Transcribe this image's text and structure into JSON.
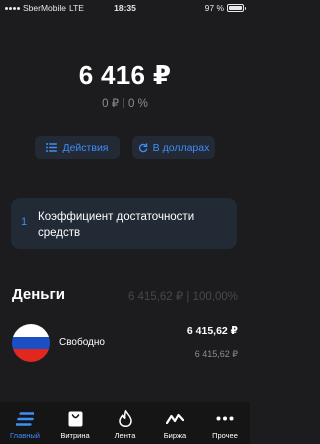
{
  "status_bar": {
    "carrier": "SberMobile",
    "network": "LTE",
    "time": "18:35",
    "battery": "97 %",
    "battery_level": 0.97
  },
  "portfolio": {
    "balance": "6 416 ₽",
    "change_amount": "0 ₽",
    "change_percent": "0 %"
  },
  "actions": {
    "actions_label": "Действия",
    "dollars_label": "В долларах",
    "accent_color": "#3e8ef7"
  },
  "ratio_card": {
    "number": "1",
    "text": "Коэффициент достаточности средств"
  },
  "money": {
    "title": "Деньги",
    "total": "6 415,62 ₽ | 100,00%",
    "items": [
      {
        "label": "Свободно",
        "value": "6 415,62 ₽",
        "sub_value": "6 415,62 ₽",
        "flag_colors": [
          "#ffffff",
          "#1c4fc4",
          "#e0281f"
        ]
      }
    ]
  },
  "tabbar": {
    "tabs": [
      {
        "label": "Главный",
        "icon": "home-icon",
        "active": true
      },
      {
        "label": "Витрина",
        "icon": "shopping-bag-icon",
        "active": false
      },
      {
        "label": "Лента",
        "icon": "flame-icon",
        "active": false
      },
      {
        "label": "Биржа",
        "icon": "chart-line-icon",
        "active": false
      },
      {
        "label": "Прочее",
        "icon": "more-icon",
        "active": false
      }
    ]
  }
}
